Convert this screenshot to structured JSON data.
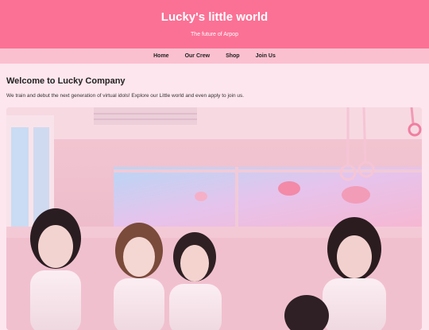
{
  "header": {
    "title": "Lucky's little world",
    "tagline": "The future of Arpop"
  },
  "nav": {
    "items": [
      {
        "label": "Home"
      },
      {
        "label": "Our Crew"
      },
      {
        "label": "Shop"
      },
      {
        "label": "Join Us"
      }
    ]
  },
  "main": {
    "heading": "Welcome to Lucky Company",
    "intro": "We train and debut the next generation of virtual idols! Explore our Little world and even apply to join us."
  },
  "colors": {
    "header_bg": "#fb7195",
    "nav_bg": "#fbc0d0",
    "page_bg": "#fde6ee"
  }
}
